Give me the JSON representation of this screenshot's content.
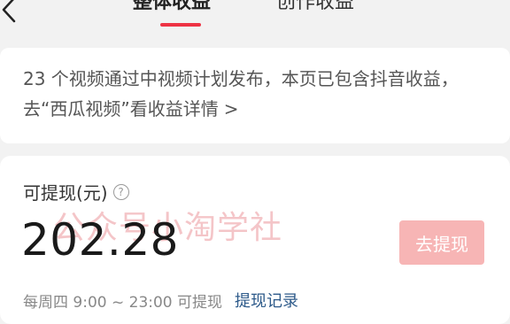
{
  "header": {
    "tabs": [
      {
        "label": "整体收益",
        "active": true
      },
      {
        "label": "创作收益",
        "active": false
      }
    ],
    "accent_color": "#ee3344"
  },
  "notice": {
    "text": "23 个视频通过中视频计划发布，本页已包含抖音收益，去“西瓜视频”看收益详情",
    "chevron": ">"
  },
  "balance": {
    "label": "可提现(元)",
    "help": "?",
    "amount": "202.28",
    "watermark": "公众号小淘学社",
    "withdraw_button": "去提现",
    "button_color": "#f7b5b5",
    "schedule": "每周四 9:00 ~ 23:00 可提现",
    "record_link": "提现记录"
  }
}
